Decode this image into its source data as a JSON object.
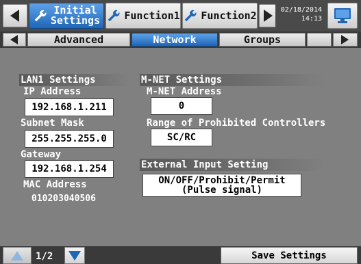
{
  "header": {
    "tabs": [
      {
        "label": "Initial\nSettings",
        "active": true
      },
      {
        "label": "Function1",
        "active": false
      },
      {
        "label": "Function2",
        "active": false
      }
    ],
    "date": "02/18/2014",
    "time": "14:13"
  },
  "subtabs": [
    {
      "label": "Advanced",
      "active": false
    },
    {
      "label": "Network",
      "active": true
    },
    {
      "label": "Groups",
      "active": false
    },
    {
      "label": "",
      "active": false
    }
  ],
  "lan": {
    "title": "LAN1 Settings",
    "ip_label": "IP Address",
    "ip_value": "192.168.1.211",
    "subnet_label": "Subnet Mask",
    "subnet_value": "255.255.255.0",
    "gateway_label": "Gateway",
    "gateway_value": "192.168.1.254",
    "mac_label": "MAC Address",
    "mac_value": "010203040506"
  },
  "mnet": {
    "title": "M-NET Settings",
    "address_label": "M-NET Address",
    "address_value": "0",
    "range_label": "Range of Prohibited Controllers",
    "range_value": "SC/RC"
  },
  "external": {
    "title": "External Input Setting",
    "value_line1": "ON/OFF/Prohibit/Permit",
    "value_line2": "(Pulse signal)"
  },
  "footer": {
    "page": "1/2",
    "save_label": "Save Settings"
  },
  "colors": {
    "accent": "#1f66b8",
    "panel": "#808080"
  }
}
